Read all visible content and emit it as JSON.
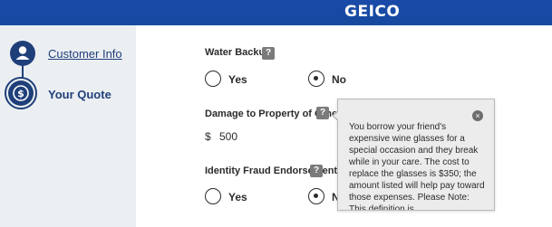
{
  "header": {
    "brand": "GEICO"
  },
  "sidebar": {
    "steps": [
      {
        "label": "Customer Info",
        "icon": "person-icon",
        "status": "completed"
      },
      {
        "label": "Your Quote",
        "icon": "dollar-icon",
        "status": "current"
      }
    ]
  },
  "questions": {
    "water_backup": {
      "title": "Water Backup",
      "help": "?",
      "options": [
        "Yes",
        "No"
      ],
      "selected": "No"
    },
    "damage_property": {
      "title": "Damage to Property of Others",
      "help": "?",
      "currency": "$",
      "value": "500"
    },
    "identity_fraud": {
      "title": "Identity Fraud Endorsement",
      "help": "?",
      "options": [
        "Yes",
        "N"
      ],
      "selected": "No"
    }
  },
  "tooltip": {
    "text": "You borrow your friend's expensive wine glasses for a special occasion and they break while in your care. The cost to replace the glasses is $350; the amount listed will help pay toward those expenses. Please Note: This definition is",
    "close": "×"
  },
  "colors": {
    "header_blue": "#154a9f",
    "sidebar_bg": "#eceff2",
    "step_navy": "#1f3f7a",
    "help_grey": "#7b7b7b"
  }
}
